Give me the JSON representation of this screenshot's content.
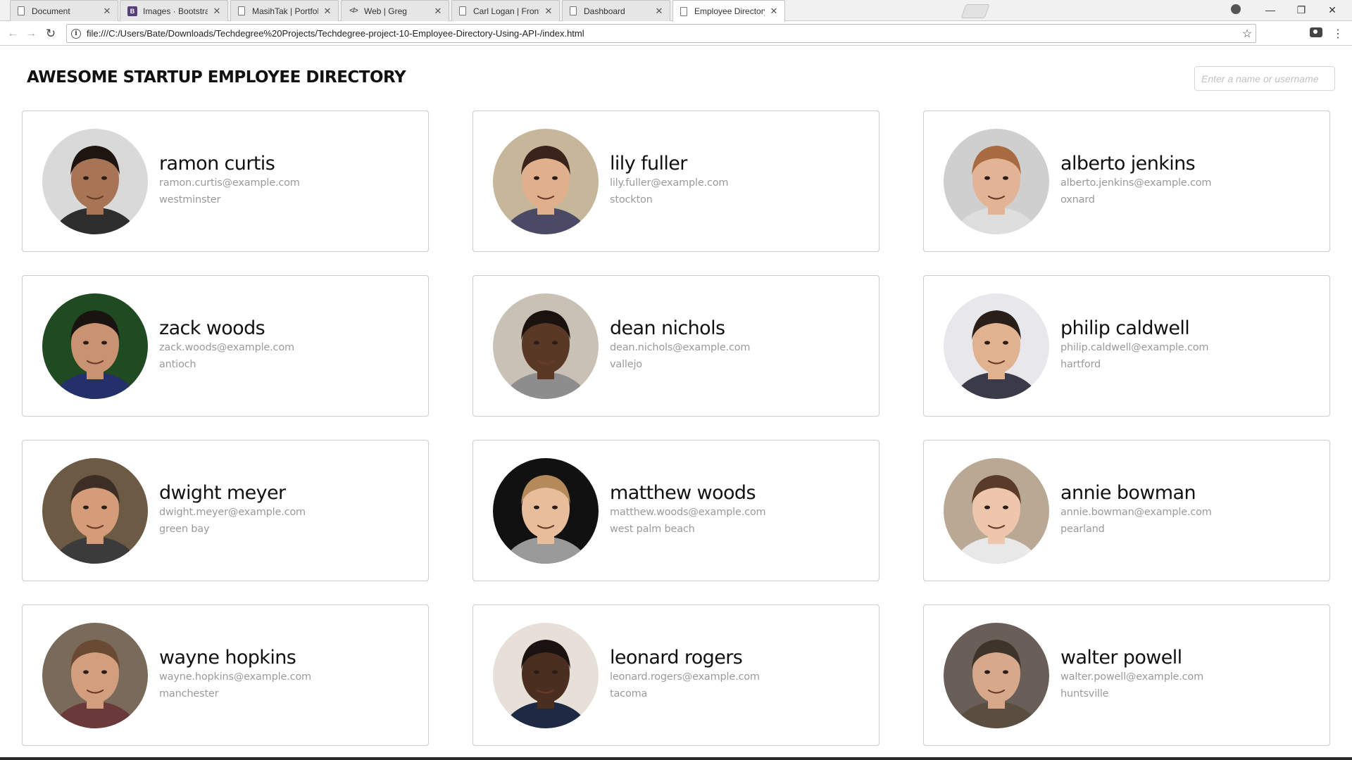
{
  "browser": {
    "tabs": [
      {
        "label": "Document",
        "icon": "doc-icon",
        "active": false
      },
      {
        "label": "Images · Bootstrap",
        "icon": "bootstrap-icon",
        "active": false
      },
      {
        "label": "MasihTak | Portfolio",
        "icon": "doc-icon",
        "active": false
      },
      {
        "label": "Web | Greg",
        "icon": "code-icon",
        "active": false
      },
      {
        "label": "Carl Logan | Front-End W",
        "icon": "doc-icon",
        "active": false
      },
      {
        "label": "Dashboard",
        "icon": "doc-icon",
        "active": false
      },
      {
        "label": "Employee Directory",
        "icon": "doc-icon",
        "active": true
      }
    ],
    "url": "file:///C:/Users/Bate/Downloads/Techdegree%20Projects/Techdegree-project-10-Employee-Directory-Using-API-/index.html"
  },
  "page": {
    "title": "AWESOME STARTUP EMPLOYEE DIRECTORY",
    "search_placeholder": "Enter a name or username"
  },
  "employees": [
    {
      "name": "ramon curtis",
      "email": "ramon.curtis@example.com",
      "city": "westminster"
    },
    {
      "name": "lily fuller",
      "email": "lily.fuller@example.com",
      "city": "stockton"
    },
    {
      "name": "alberto jenkins",
      "email": "alberto.jenkins@example.com",
      "city": "oxnard"
    },
    {
      "name": "zack woods",
      "email": "zack.woods@example.com",
      "city": "antioch"
    },
    {
      "name": "dean nichols",
      "email": "dean.nichols@example.com",
      "city": "vallejo"
    },
    {
      "name": "philip caldwell",
      "email": "philip.caldwell@example.com",
      "city": "hartford"
    },
    {
      "name": "dwight meyer",
      "email": "dwight.meyer@example.com",
      "city": "green bay"
    },
    {
      "name": "matthew woods",
      "email": "matthew.woods@example.com",
      "city": "west palm beach"
    },
    {
      "name": "annie bowman",
      "email": "annie.bowman@example.com",
      "city": "pearland"
    },
    {
      "name": "wayne hopkins",
      "email": "wayne.hopkins@example.com",
      "city": "manchester"
    },
    {
      "name": "leonard rogers",
      "email": "leonard.rogers@example.com",
      "city": "tacoma"
    },
    {
      "name": "walter powell",
      "email": "walter.powell@example.com",
      "city": "huntsville"
    }
  ],
  "avatar_palette": [
    {
      "bg": "#d9d9d9",
      "skin": "#a87456",
      "hair": "#1e1410",
      "shirt": "#2e2e2e"
    },
    {
      "bg": "#c7b79a",
      "skin": "#e0b08d",
      "hair": "#3a231a",
      "shirt": "#4a4a66"
    },
    {
      "bg": "#cfcfcf",
      "skin": "#e3b395",
      "hair": "#a86a40",
      "shirt": "#dedede"
    },
    {
      "bg": "#1f4a22",
      "skin": "#c99372",
      "hair": "#1a1410",
      "shirt": "#24306a"
    },
    {
      "bg": "#c9c1b5",
      "skin": "#5a3826",
      "hair": "#1a120e",
      "shirt": "#8d8d8d"
    },
    {
      "bg": "#e8e8ec",
      "skin": "#e1b290",
      "hair": "#2a1e18",
      "shirt": "#3a3a48"
    },
    {
      "bg": "#6d5a44",
      "skin": "#d49c78",
      "hair": "#3c2e24",
      "shirt": "#3b3b3b"
    },
    {
      "bg": "#111111",
      "skin": "#e8bd9c",
      "hair": "#b48a5a",
      "shirt": "#9a9a9a"
    },
    {
      "bg": "#b9a894",
      "skin": "#edc6ab",
      "hair": "#5a3a28",
      "shirt": "#e8e8e8"
    },
    {
      "bg": "#7a6a5a",
      "skin": "#d39e7e",
      "hair": "#6a4a32",
      "shirt": "#6a3a3a"
    },
    {
      "bg": "#e6e0d8",
      "skin": "#4a2e20",
      "hair": "#1a1210",
      "shirt": "#1e2a44"
    },
    {
      "bg": "#6a5e58",
      "skin": "#d8a88a",
      "hair": "#3e342c",
      "shirt": "#5a4e40"
    }
  ]
}
